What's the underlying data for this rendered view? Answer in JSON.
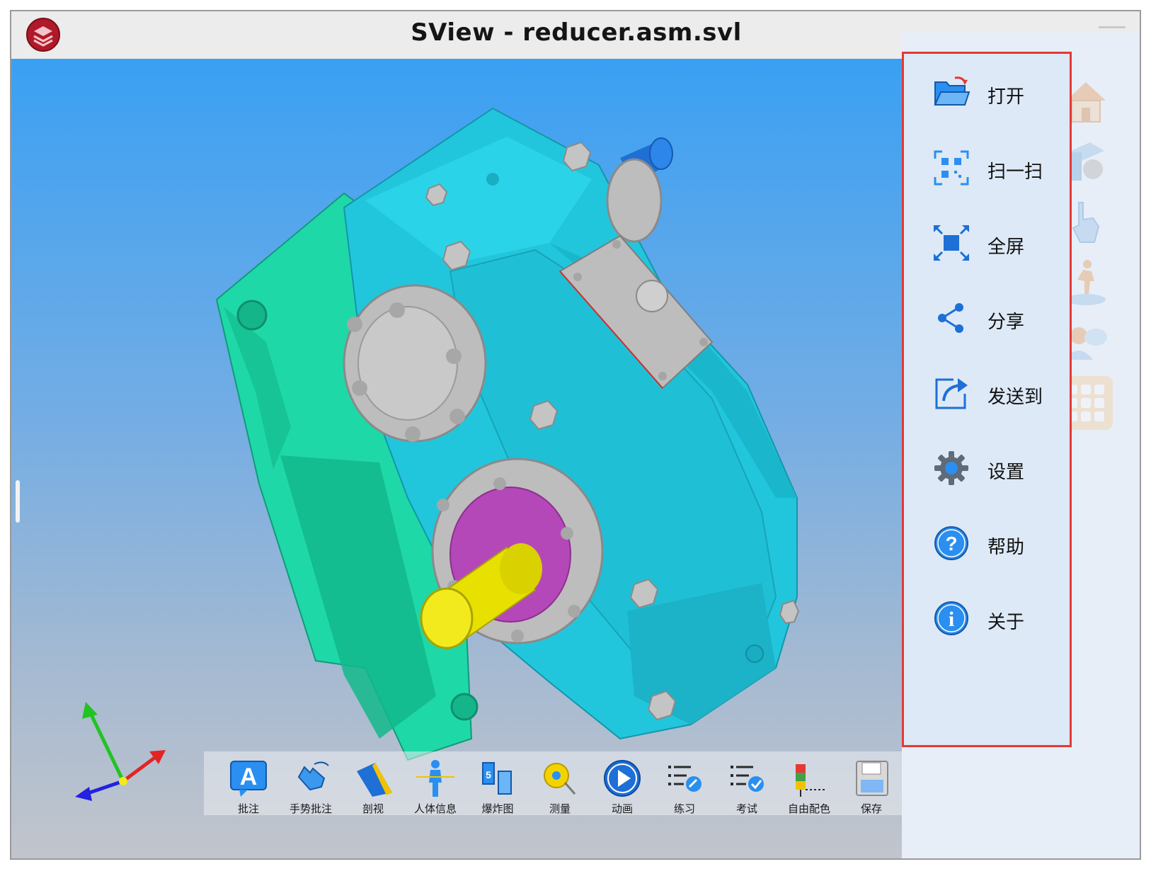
{
  "window": {
    "title": "SView - reducer.asm.svl"
  },
  "menu": {
    "items": [
      {
        "label": "打开",
        "icon": "folder-open-icon"
      },
      {
        "label": "扫一扫",
        "icon": "qr-scan-icon"
      },
      {
        "label": "全屏",
        "icon": "fullscreen-icon"
      },
      {
        "label": "分享",
        "icon": "share-icon"
      },
      {
        "label": "发送到",
        "icon": "send-to-icon"
      },
      {
        "label": "设置",
        "icon": "gear-icon"
      },
      {
        "label": "帮助",
        "icon": "help-icon"
      },
      {
        "label": "关于",
        "icon": "info-icon"
      }
    ],
    "highlight_color": "#e53935"
  },
  "toolbar": {
    "items": [
      {
        "label": "批注",
        "icon": "annotation-icon"
      },
      {
        "label": "手势批注",
        "icon": "gesture-annotation-icon"
      },
      {
        "label": "剖视",
        "icon": "section-view-icon"
      },
      {
        "label": "人体信息",
        "icon": "human-info-icon"
      },
      {
        "label": "爆炸图",
        "icon": "explode-icon"
      },
      {
        "label": "测量",
        "icon": "measure-icon"
      },
      {
        "label": "动画",
        "icon": "play-icon"
      },
      {
        "label": "练习",
        "icon": "practice-icon"
      },
      {
        "label": "考试",
        "icon": "exam-icon"
      },
      {
        "label": "自由配色",
        "icon": "free-color-icon"
      },
      {
        "label": "保存",
        "icon": "save-icon"
      }
    ]
  },
  "dock": {
    "icons": [
      "home-icon",
      "view-settings-icon",
      "touch-icon",
      "walk-mode-icon",
      "collaboration-icon",
      "apps-grid-icon"
    ]
  },
  "colors": {
    "housing_front": "#22c6dc",
    "housing_back": "#1fd8a8",
    "flange": "#bdbdbd",
    "shaft_yellow": "#e8e000",
    "shaft_blue": "#1f6fd6",
    "seal_purple": "#b548b8"
  }
}
